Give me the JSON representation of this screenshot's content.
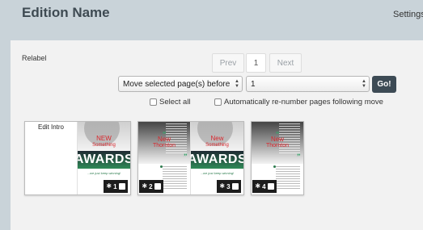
{
  "header": {
    "title": "Edition Name",
    "settings_label": "Settings"
  },
  "toolbar": {
    "relabel_label": "Relabel",
    "pager": {
      "prev_label": "Prev",
      "current_page": "1",
      "next_label": "Next"
    },
    "move_select": {
      "selected": "Move selected page(s) before"
    },
    "target_page_select": {
      "selected": "1"
    },
    "go_label": "Go!",
    "select_all_label": "Select all",
    "renumber_label": "Automatically re-number pages following move"
  },
  "spreads": [
    {
      "left_page": {
        "label": "Edit Intro"
      },
      "right_page": {
        "red_text": [
          "NEW",
          "Something"
        ],
        "banner": "AWARDS",
        "tagline": "...we just keep winning!",
        "number": "1",
        "icon": "gear-icon"
      }
    },
    {
      "left_page": {
        "red_text": [
          "New",
          "Thornton"
        ],
        "number": "2",
        "icon": "gear-icon"
      },
      "right_page": {
        "red_text": [
          "New",
          "Something"
        ],
        "banner": "AWARDS",
        "tagline": "...we just keep winning!",
        "number": "3",
        "icon": "gear-icon"
      }
    },
    {
      "left_page": {
        "red_text": [
          "New",
          "Thornton"
        ],
        "number": "4",
        "icon": "gear-icon"
      }
    }
  ],
  "colors": {
    "header_bg": "#c9d3d9",
    "panel_bg": "#f2f2f2",
    "go_button": "#3d4b55",
    "accent_red": "#d9262c",
    "accent_green": "#2f8a57"
  }
}
